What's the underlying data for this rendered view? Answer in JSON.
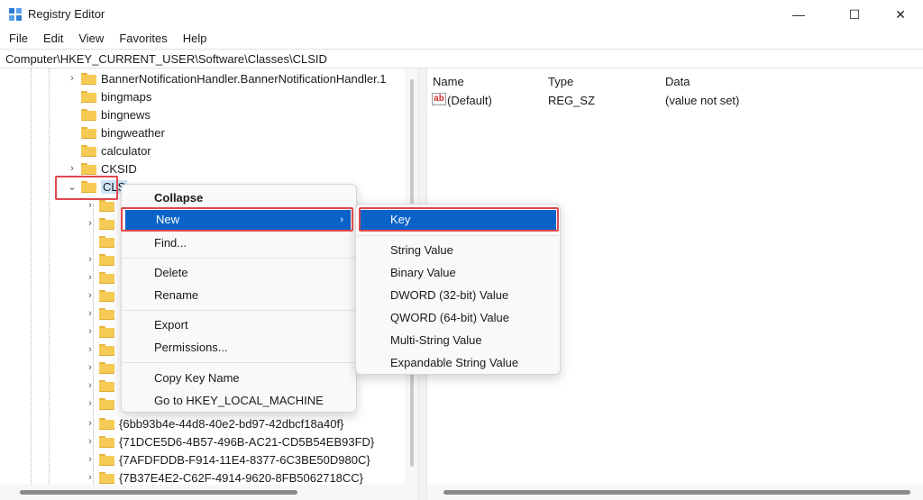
{
  "window": {
    "title": "Registry Editor",
    "minimize_glyph": "—",
    "maximize_glyph": "☐",
    "close_glyph": "✕"
  },
  "menu": [
    "File",
    "Edit",
    "View",
    "Favorites",
    "Help"
  ],
  "address": "Computer\\HKEY_CURRENT_USER\\Software\\Classes\\CLSID",
  "tree": {
    "rows": [
      "BannerNotificationHandler.BannerNotificationHandler.1",
      "bingmaps",
      "bingnews",
      "bingweather",
      "calculator",
      "CKSID",
      "CLSID"
    ],
    "selected_label": "CLS",
    "child_rows": [
      "{6bb93b4e-44d8-40e2-bd97-42dbcf18a40f}",
      "{71DCE5D6-4B57-496B-AC21-CD5B54EB93FD}",
      "{7AFDFDDB-F914-11E4-8377-6C3BE50D980C}",
      "{7B37E4E2-C62F-4914-9620-8FB5062718CC}"
    ]
  },
  "values": {
    "columns": [
      "Name",
      "Type",
      "Data"
    ],
    "rows": [
      {
        "name": "(Default)",
        "type": "REG_SZ",
        "data": "(value not set)",
        "icon": "ab-string-icon"
      }
    ]
  },
  "context_menu": {
    "collapse": "Collapse",
    "new": "New",
    "find": "Find...",
    "delete": "Delete",
    "rename": "Rename",
    "export": "Export",
    "permissions": "Permissions...",
    "copy_key_name": "Copy Key Name",
    "goto": "Go to HKEY_LOCAL_MACHINE"
  },
  "submenu": {
    "key": "Key",
    "string_value": "String Value",
    "binary_value": "Binary Value",
    "dword": "DWORD (32-bit) Value",
    "qword": "QWORD (64-bit) Value",
    "multi_string": "Multi-String Value",
    "expandable_string": "Expandable String Value"
  },
  "colors": {
    "highlight": "#0a63c9",
    "annotation_red": "#e0484d",
    "folder": "#f6cb55"
  }
}
